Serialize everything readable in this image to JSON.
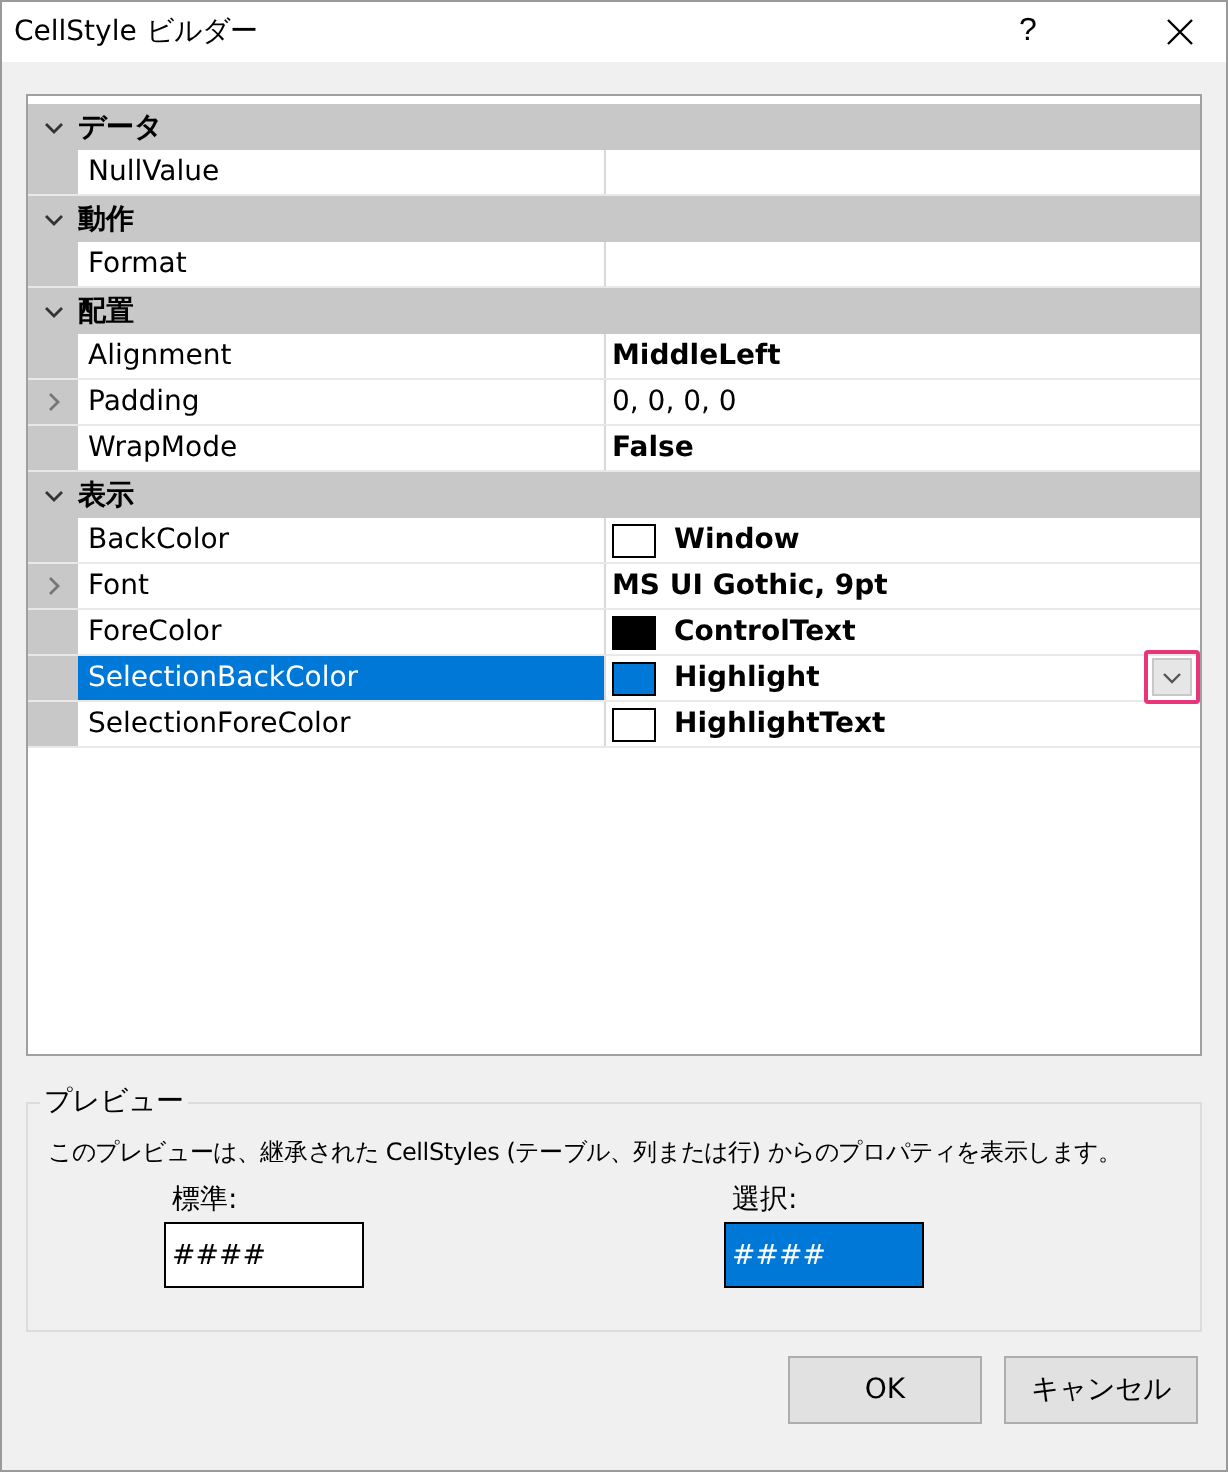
{
  "window": {
    "title": "CellStyle ビルダー",
    "help": "?"
  },
  "grid": {
    "categories": [
      {
        "name": "データ",
        "expanded": true,
        "properties": [
          {
            "name": "NullValue",
            "selected": false
          }
        ]
      },
      {
        "name": "動作",
        "expanded": true,
        "properties": [
          {
            "name": "Format",
            "selected": false
          }
        ]
      },
      {
        "name": "配置",
        "expanded": true,
        "properties": [
          {
            "name": "Alignment",
            "value": "MiddleLeft",
            "bold": true,
            "selected": false
          },
          {
            "name": "Padding",
            "value": "0, 0, 0, 0",
            "bold": false,
            "expandable": true,
            "selected": false
          },
          {
            "name": "WrapMode",
            "value": "False",
            "bold": true,
            "selected": false
          }
        ]
      },
      {
        "name": "表示",
        "expanded": true,
        "properties": [
          {
            "name": "BackColor",
            "value": "Window",
            "bold": true,
            "selected": false,
            "color": "#ffffff"
          },
          {
            "name": "Font",
            "value": "MS UI Gothic, 9pt",
            "bold": true,
            "expandable": true,
            "selected": false
          },
          {
            "name": "ForeColor",
            "value": "ControlText",
            "bold": true,
            "selected": false,
            "color": "#000000"
          },
          {
            "name": "SelectionBackColor",
            "value": "Highlight",
            "bold": true,
            "selected": true,
            "color": "#0078d7",
            "dropdown_highlighted": true
          },
          {
            "name": "SelectionForeColor",
            "value": "HighlightText",
            "bold": true,
            "selected": false,
            "color": "#ffffff"
          }
        ]
      }
    ]
  },
  "preview": {
    "title": "プレビュー",
    "description": "このプレビューは、継承された CellStyles (テーブル、列または行) からのプロパティを表示します。",
    "samples": [
      {
        "label": "標準:",
        "text": "####",
        "selected": false
      },
      {
        "label": "選択:",
        "text": "####",
        "selected": true
      }
    ]
  },
  "buttons": [
    "OK",
    "キャンセル"
  ]
}
